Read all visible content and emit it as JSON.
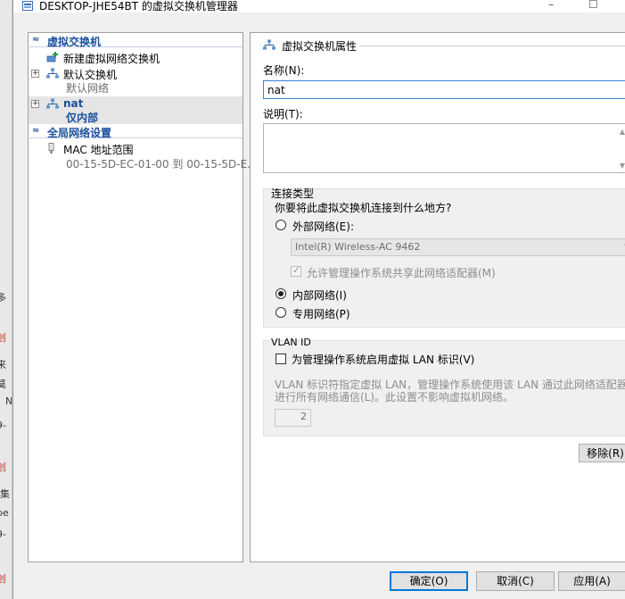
{
  "window": {
    "title": "DESKTOP-JHE54BT 的虚拟交换机管理器",
    "minimize_glyph": "–",
    "maximize_glyph": "☐"
  },
  "background_fragments": [
    "多",
    "创",
    "来",
    "莫",
    "N",
    "9-",
    "创",
    "-集",
    "be",
    "9-",
    "创"
  ],
  "tree": {
    "section_switches": "虚拟交换机",
    "new_switch": "新建虚拟网络交换机",
    "default_switch": {
      "name": "默认交换机",
      "sub": "默认网络"
    },
    "nat_switch": {
      "name": "nat",
      "sub": "仅内部"
    },
    "section_global": "全局网络设置",
    "mac_range": {
      "name": "MAC 地址范围",
      "sub": "00-15-5D-EC-01-00 到 00-15-5D-E..."
    },
    "expander": "+",
    "collapse_glyph": "≈"
  },
  "props": {
    "header": "虚拟交换机属性",
    "name_label": "名称(N):",
    "name_value": "nat",
    "desc_label": "说明(T):",
    "connection_type_title": "连接类型",
    "connection_question": "你要将此虚拟交换机连接到什么地方?",
    "external_label": "外部网络(E):",
    "adapter_value": "Intel(R) Wireless-AC 9462",
    "allow_share_label": "允许管理操作系统共享此网络适配器(M)",
    "internal_label": "内部网络(I)",
    "private_label": "专用网络(P)",
    "vlan_title": "VLAN ID",
    "vlan_enable_label": "为管理操作系统启用虚拟 LAN 标识(V)",
    "vlan_desc": "VLAN 标识符指定虚拟 LAN，管理操作系统使用该 LAN 通过此网络适配器进行所有网络通信(L)。此设置不影响虚拟机网络。",
    "vlan_value": "2",
    "remove_button": "移除(R)"
  },
  "footer": {
    "ok": "确定(O)",
    "cancel": "取消(C)",
    "apply": "应用(A)"
  },
  "colors": {
    "accent": "#1c4f9c",
    "input_focus": "#3b7fd1"
  }
}
